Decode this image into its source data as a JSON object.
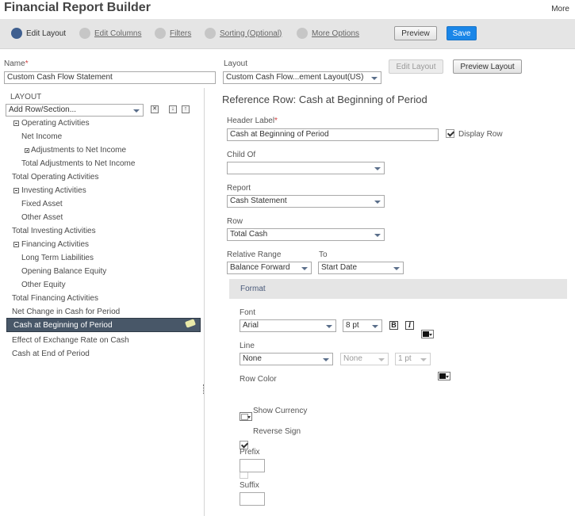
{
  "header": {
    "title": "Financial Report Builder",
    "more_label": "More"
  },
  "steps": [
    {
      "label": "Edit Layout",
      "active": true
    },
    {
      "label": "Edit Columns",
      "active": false
    },
    {
      "label": "Filters",
      "active": false
    },
    {
      "label": "Sorting (Optional)",
      "active": false
    },
    {
      "label": "More Options",
      "active": false
    }
  ],
  "toolbar": {
    "preview_label": "Preview",
    "save_label": "Save"
  },
  "name_field": {
    "label": "Name",
    "value": "Custom Cash Flow Statement"
  },
  "layout_field": {
    "label": "Layout",
    "value": "Custom Cash Flow...ement Layout(US)"
  },
  "layout_buttons": {
    "edit_label": "Edit Layout",
    "preview_label": "Preview Layout"
  },
  "left_panel": {
    "header": "LAYOUT",
    "add_row_value": "Add Row/Section...",
    "icons": {
      "delete": "x-icon",
      "move_down": "arrow-down-icon",
      "move_up": "arrow-up-icon"
    },
    "tree": [
      {
        "label": "Operating Activities",
        "collapse": true
      },
      {
        "label": "Net Income"
      },
      {
        "label": "Adjustments to Net Income",
        "expand": true
      },
      {
        "label": "Total Adjustments to Net Income"
      },
      {
        "label": "Total Operating Activities"
      },
      {
        "label": "Investing Activities",
        "collapse": true
      },
      {
        "label": "Fixed Asset"
      },
      {
        "label": "Other Asset"
      },
      {
        "label": "Total Investing Activities"
      },
      {
        "label": "Financing Activities",
        "collapse": true
      },
      {
        "label": "Long Term Liabilities"
      },
      {
        "label": "Opening Balance Equity"
      },
      {
        "label": "Other Equity"
      },
      {
        "label": "Total Financing Activities"
      },
      {
        "label": "Net Change in Cash for Period"
      },
      {
        "label": "Cash at Beginning of Period",
        "selected": true
      },
      {
        "label": "Effect of Exchange Rate on Cash"
      },
      {
        "label": "Cash at End of Period"
      }
    ]
  },
  "detail": {
    "title": "Reference Row: Cash at Beginning of Period",
    "header_label": {
      "label": "Header Label",
      "value": "Cash at Beginning of Period"
    },
    "display_row": {
      "label": "Display Row",
      "checked": true
    },
    "child_of": {
      "label": "Child Of",
      "value": ""
    },
    "report": {
      "label": "Report",
      "value": "Cash Statement"
    },
    "row": {
      "label": "Row",
      "value": "Total Cash"
    },
    "relative_range": {
      "label": "Relative Range",
      "value": "Balance Forward"
    },
    "to": {
      "label": "To",
      "value": "Start Date"
    },
    "format": {
      "header": "Format",
      "font": {
        "label": "Font",
        "family": "Arial",
        "size": "8 pt",
        "bold_glyph": "B",
        "italic_glyph": "I"
      },
      "line": {
        "label": "Line",
        "style": "None",
        "style2": "None",
        "weight": "1 pt"
      },
      "row_color": {
        "label": "Row Color"
      },
      "show_currency": {
        "label": "Show Currency",
        "checked": true
      },
      "reverse_sign": {
        "label": "Reverse Sign",
        "checked": false
      },
      "prefix": {
        "label": "Prefix",
        "value": ""
      },
      "suffix": {
        "label": "Suffix",
        "value": ""
      }
    }
  }
}
